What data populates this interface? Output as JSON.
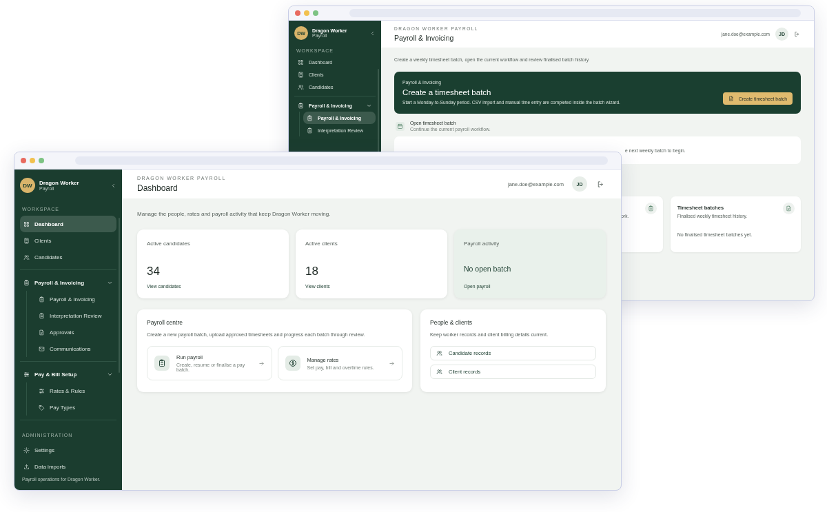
{
  "back_window": {
    "sidebar": {
      "brand": {
        "initials": "DW",
        "name": "Dragon Worker",
        "subtitle": "Payroll"
      },
      "section": "WORKSPACE",
      "items": [
        {
          "label": "Dashboard",
          "selected": false
        },
        {
          "label": "Clients",
          "selected": false
        },
        {
          "label": "Candidates",
          "selected": false
        }
      ],
      "groups": [
        {
          "label": "Payroll & Invoicing",
          "expanded": true,
          "children": [
            {
              "label": "Payroll & Invoicing",
              "selected": true
            },
            {
              "label": "Interpretation Review",
              "selected": false
            }
          ]
        }
      ]
    },
    "header": {
      "eyebrow": "DRAGON WORKER PAYROLL",
      "title": "Payroll & Invoicing",
      "email": "jane.doe@example.com",
      "initials": "JD"
    },
    "intro": "Create a weekly timesheet batch, open the current workflow and review finalised batch history.",
    "hero": {
      "eyebrow": "Payroll & Invoicing",
      "title": "Create a timesheet batch",
      "text": "Start a Monday-to-Sunday period. CSV import and manual time entry are completed inside the batch wizard.",
      "button": "Create timesheet batch"
    },
    "open_batch": {
      "title": "Open timesheet batch",
      "subtitle": "Continue the current payroll workflow."
    },
    "notice": "e next weekly batch to begin.",
    "cards": [
      {
        "text": "ork."
      },
      {
        "title": "Timesheet batches",
        "text": "Finalised weekly timesheet history.",
        "note": "No finalised timesheet batches yet."
      }
    ]
  },
  "front_window": {
    "sidebar": {
      "brand": {
        "initials": "DW",
        "name": "Dragon Worker",
        "subtitle": "Payroll"
      },
      "section": "WORKSPACE",
      "items": [
        {
          "label": "Dashboard",
          "selected": true
        },
        {
          "label": "Clients",
          "selected": false
        },
        {
          "label": "Candidates",
          "selected": false
        }
      ],
      "groups": [
        {
          "label": "Payroll & Invoicing",
          "expanded": true,
          "children": [
            {
              "label": "Payroll & Invoicing",
              "selected": false
            },
            {
              "label": "Interpretation Review",
              "selected": false
            },
            {
              "label": "Approvals",
              "selected": false
            },
            {
              "label": "Communications",
              "selected": false
            }
          ]
        },
        {
          "label": "Pay & Bill Setup",
          "expanded": true,
          "children": [
            {
              "label": "Rates & Rules",
              "selected": false
            },
            {
              "label": "Pay Types",
              "selected": false
            }
          ]
        }
      ],
      "admin_section": "ADMINISTRATION",
      "admin_items": [
        {
          "label": "Settings",
          "selected": false
        },
        {
          "label": "Data imports",
          "selected": false
        }
      ],
      "footer": "Payroll operations for Dragon Worker."
    },
    "header": {
      "eyebrow": "DRAGON WORKER PAYROLL",
      "title": "Dashboard",
      "email": "jane.doe@example.com",
      "initials": "JD"
    },
    "intro": "Manage the people, rates and payroll activity that keep Dragon Worker moving.",
    "stats": [
      {
        "kind": "count",
        "label": "Active candidates",
        "value": "34",
        "link": "View candidates"
      },
      {
        "kind": "count",
        "label": "Active clients",
        "value": "18",
        "link": "View clients"
      },
      {
        "kind": "status",
        "label": "Payroll activity",
        "value": "No open batch",
        "link": "Open payroll"
      }
    ],
    "payroll_centre": {
      "title": "Payroll centre",
      "text": "Create a new payroll batch, upload approved timesheets and progress each batch through review.",
      "actions": [
        {
          "title": "Run payroll",
          "text": "Create, resume or finalise a pay batch."
        },
        {
          "title": "Manage rates",
          "text": "Set pay, bill and overtime rules."
        }
      ]
    },
    "people": {
      "title": "People & clients",
      "text": "Keep worker records and client billing details current.",
      "links": [
        "Candidate records",
        "Client records"
      ]
    }
  }
}
